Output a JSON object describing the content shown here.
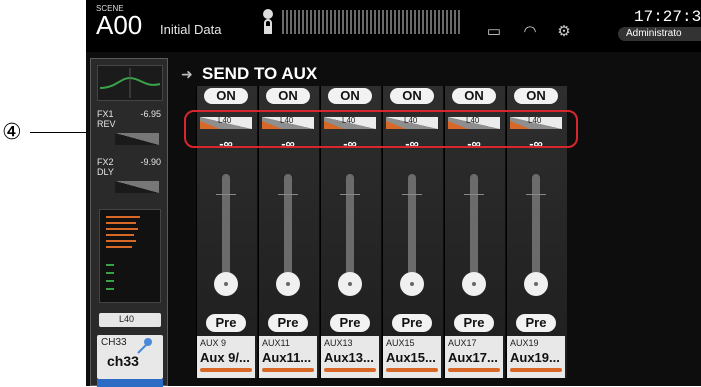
{
  "annotation": {
    "number": "④"
  },
  "topbar": {
    "scene_label": "SCENE",
    "scene_number": "A00",
    "scene_title": "Initial Data",
    "clock": "17:27:3",
    "user": "Administrato"
  },
  "strip": {
    "fx1": {
      "name": "FX1",
      "type": "REV",
      "value": "-6.95"
    },
    "fx2": {
      "name": "FX2",
      "type": "DLY",
      "value": "-9.90"
    },
    "pan": "L40",
    "channel_id": "CH33",
    "channel_name": "ch33",
    "color": "#2c6cc4"
  },
  "header": {
    "title": "SEND TO AUX"
  },
  "channels": [
    {
      "on": "ON",
      "pan": "L40",
      "level": "-∞",
      "pre": "Pre",
      "id": "AUX 9",
      "name": "Aux 9/..."
    },
    {
      "on": "ON",
      "pan": "L40",
      "level": "-∞",
      "pre": "Pre",
      "id": "AUX11",
      "name": "Aux11..."
    },
    {
      "on": "ON",
      "pan": "L40",
      "level": "-∞",
      "pre": "Pre",
      "id": "AUX13",
      "name": "Aux13..."
    },
    {
      "on": "ON",
      "pan": "L40",
      "level": "-∞",
      "pre": "Pre",
      "id": "AUX15",
      "name": "Aux15..."
    },
    {
      "on": "ON",
      "pan": "L40",
      "level": "-∞",
      "pre": "Pre",
      "id": "AUX17",
      "name": "Aux17..."
    },
    {
      "on": "ON",
      "pan": "L40",
      "level": "-∞",
      "pre": "Pre",
      "id": "AUX19",
      "name": "Aux19..."
    }
  ]
}
